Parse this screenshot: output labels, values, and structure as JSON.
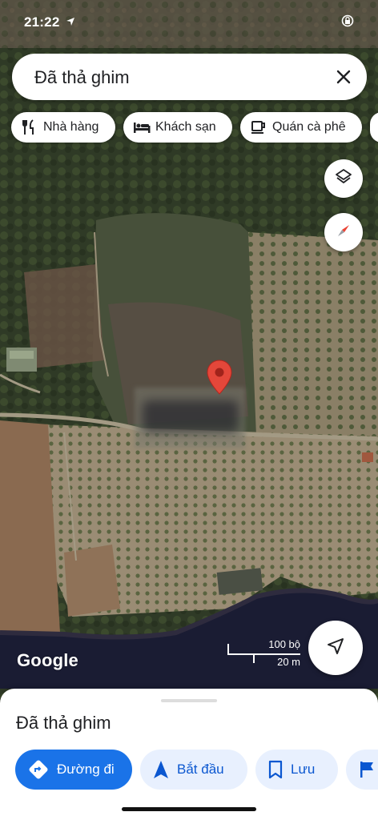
{
  "status_bar": {
    "time": "21:22"
  },
  "search": {
    "query": "Đã thả ghim"
  },
  "chips": [
    {
      "label": "Nhà hàng",
      "icon": "fork-knife-icon"
    },
    {
      "label": "Khách sạn",
      "icon": "bed-icon"
    },
    {
      "label": "Quán cà phê",
      "icon": "coffee-cup-icon"
    }
  ],
  "map": {
    "scale_feet": "100 bộ",
    "scale_meters": "20 m",
    "attribution": "Google",
    "pin_color": "#e4473a"
  },
  "sheet": {
    "title": "Đã thả ghim",
    "actions": [
      {
        "label": "Đường đi",
        "icon": "directions-icon"
      },
      {
        "label": "Bắt đầu",
        "icon": "navigation-arrow-icon"
      },
      {
        "label": "Lưu",
        "icon": "bookmark-icon"
      },
      {
        "label": "",
        "icon": "flag-icon"
      }
    ]
  },
  "colors": {
    "accent": "#1a73e8",
    "secondary_button": "#e8f0fe",
    "secondary_text": "#0b57d0"
  }
}
